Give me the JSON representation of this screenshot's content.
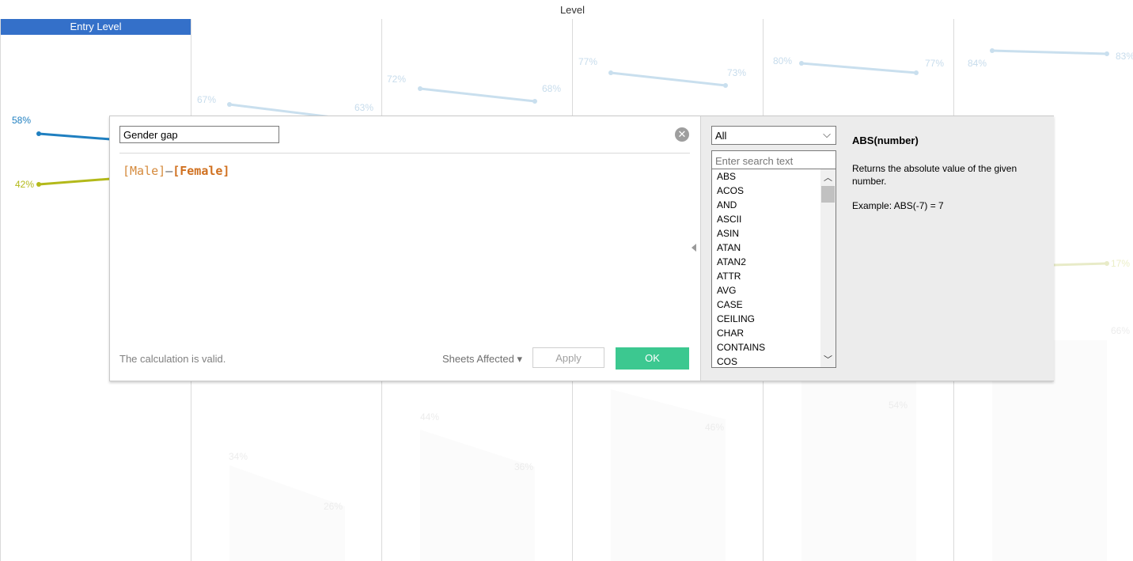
{
  "chart": {
    "header_title": "Level",
    "entry_level_label": "Entry Level",
    "label_colors": {
      "male": "#1f7fc0",
      "female": "#b3b91a"
    },
    "entry_labels": {
      "male": "58%",
      "female": "42%"
    },
    "faint_labels_blue": [
      "67%",
      "63%",
      "72%",
      "68%",
      "77%",
      "73%",
      "80%",
      "77%",
      "84%",
      "83%"
    ],
    "faint_labels_gray": [
      "34%",
      "26%",
      "44%",
      "36%",
      "46%",
      "54%",
      "66%"
    ],
    "faint_labels_yellow": [
      "17%"
    ]
  },
  "dialog": {
    "name_value": "Gender gap",
    "formula": {
      "field1": "[Male]",
      "op": "–",
      "field2": "[Female]"
    },
    "status": "The calculation is valid.",
    "sheets_affected": "Sheets Affected ▾",
    "apply_label": "Apply",
    "ok_label": "OK",
    "close_icon": "close-icon",
    "category_selected": "All",
    "search_placeholder": "Enter search text",
    "functions": [
      "ABS",
      "ACOS",
      "AND",
      "ASCII",
      "ASIN",
      "ATAN",
      "ATAN2",
      "ATTR",
      "AVG",
      "CASE",
      "CEILING",
      "CHAR",
      "CONTAINS",
      "COS"
    ],
    "help_title": "ABS(number)",
    "help_description": "Returns the absolute value of the given number.",
    "help_example": "Example: ABS(-7) = 7"
  }
}
